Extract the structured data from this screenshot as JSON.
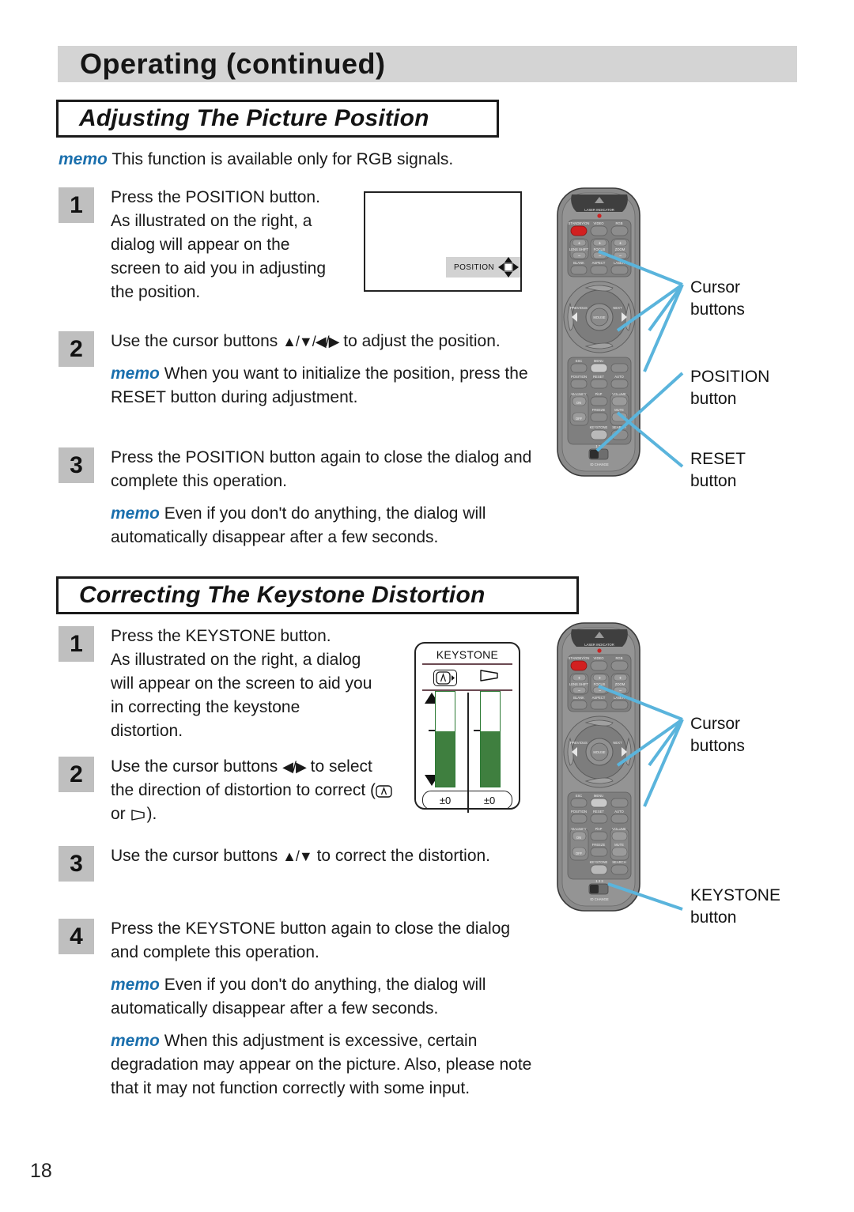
{
  "header": {
    "title": "Operating (continued)"
  },
  "page": {
    "number": "18"
  },
  "sections": [
    {
      "title": "Adjusting The Picture Position",
      "memo_lead": "This function is available only for RGB signals.",
      "memo_word": "memo",
      "steps": [
        {
          "num": "1",
          "lines": [
            "Press the POSITION button.",
            "As illustrated on the right, a",
            "dialog will appear on the",
            "screen to aid you in adjusting",
            "the position."
          ]
        },
        {
          "num": "2",
          "text_before": "Use the cursor buttons ",
          "arrows": "▲/▼/◀/▶",
          "text_after": " to adjust the position.",
          "memo": "When you want to initialize the position, press the RESET button during adjustment."
        },
        {
          "num": "3",
          "text": "Press the POSITION button again to close the dialog and complete this operation.",
          "memo": "Even if you don't do anything, the dialog will automatically disappear after a few seconds."
        }
      ]
    },
    {
      "title": "Correcting The Keystone Distortion",
      "steps": [
        {
          "num": "1",
          "lines": [
            "Press the KEYSTONE button.",
            "As illustrated on the right, a dialog",
            "will appear on the screen to aid you",
            "in correcting the keystone",
            "distortion."
          ]
        },
        {
          "num": "2",
          "text_before": "Use the cursor buttons ",
          "arrows": "◀/▶",
          "text_mid": " to select the direction of distortion to correct (",
          "text_or": " or ",
          "text_after": ")."
        },
        {
          "num": "3",
          "text_before": "Use the cursor buttons ",
          "arrows": "▲/▼",
          "text_after": " to correct the distortion."
        },
        {
          "num": "4",
          "text": "Press the KEYSTONE button again to close the dialog and complete this operation.",
          "memo": "Even if you don't do anything, the dialog will automatically disappear after a few seconds.",
          "memo2": "When this adjustment is excessive, certain degradation may appear on the picture. Also, please note that it may not function correctly with some input."
        }
      ]
    }
  ],
  "osd_position": {
    "label": "POSITION"
  },
  "osd_keystone": {
    "title": "KEYSTONE",
    "value_left": "±0",
    "value_right": "±0",
    "bar_left_fill_percent": 58,
    "bar_right_fill_percent": 58
  },
  "callouts": {
    "cursor_line1": "Cursor",
    "cursor_line2": "buttons",
    "position_line1": "POSITION",
    "position_line2": "button",
    "reset_line1": "RESET",
    "reset_line2": "button",
    "cursor2_line1": "Cursor",
    "cursor2_line2": "buttons",
    "keystone_line1": "KEYSTONE",
    "keystone_line2": "button"
  },
  "remote": {
    "laser_indicator": "LASER INDICATOR",
    "standby_on": "STANDBY/ON",
    "video": "VIDEO",
    "rgb": "RGB",
    "lens_shift": "LENS SHIFT",
    "focus": "FOCUS",
    "zoom": "ZOOM",
    "blank": "BLANK",
    "aspect": "ASPECT",
    "laser": "LASER",
    "previous": "PREVIOUS",
    "next": "NEXT",
    "mouse": "MOUSE",
    "esc": "ESC",
    "menu": "MENU",
    "position": "POSITION",
    "reset": "RESET",
    "auto": "AUTO",
    "magnify": "MAGNIFY",
    "on": "ON",
    "off": "OFF",
    "pinp": "PinP",
    "volume": "VOLUME",
    "freeze": "FREEZE",
    "mute": "MUTE",
    "keystone": "KEYSTONE",
    "search": "SEARCH",
    "id_change": "ID CHANGE",
    "id_nums": "1 2 3",
    "plus": "+",
    "minus": "−"
  },
  "colors": {
    "header_gray": "#d4d4d4",
    "step_gray": "#bfbfbf",
    "memo_blue": "#1a6fad",
    "callout_blue": "#5ab4dc",
    "bar_green": "#3f7f3f",
    "power_red": "#d8201f",
    "remote_body": "#8a8a8a"
  }
}
